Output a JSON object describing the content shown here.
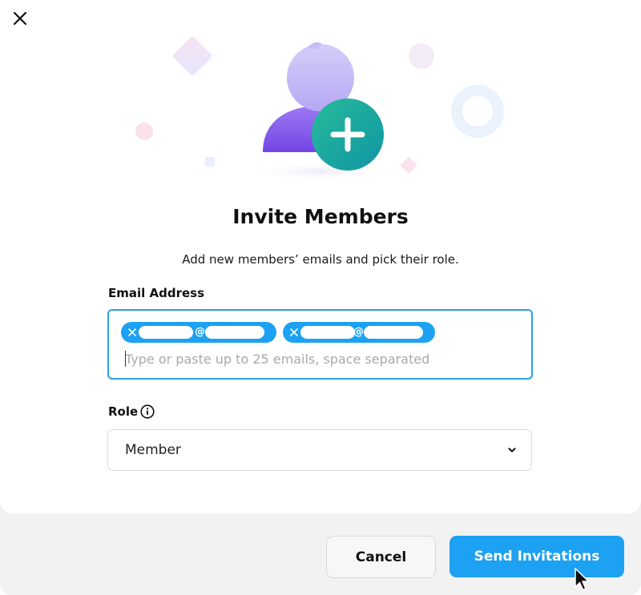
{
  "dialog": {
    "title": "Invite Members",
    "subtitle": "Add new members’ emails and pick their role."
  },
  "email": {
    "label": "Email Address",
    "placeholder": "Type or paste up to 25 emails, space separated",
    "chips": [
      {
        "separator": "@"
      },
      {
        "separator": "@"
      }
    ]
  },
  "role": {
    "label": "Role",
    "selected": "Member"
  },
  "footer": {
    "cancel_label": "Cancel",
    "send_label": "Send Invitations"
  },
  "icons": {
    "close": "close-icon",
    "info": "info-icon",
    "chevron": "chevron-down-icon",
    "chip_remove": "remove-icon",
    "illustration": "add-user-icon"
  },
  "colors": {
    "accent": "#1da1f2",
    "focus_border": "#2aa0ef",
    "plus_badge": "#1aa89a",
    "avatar": "#8b6cf0"
  }
}
